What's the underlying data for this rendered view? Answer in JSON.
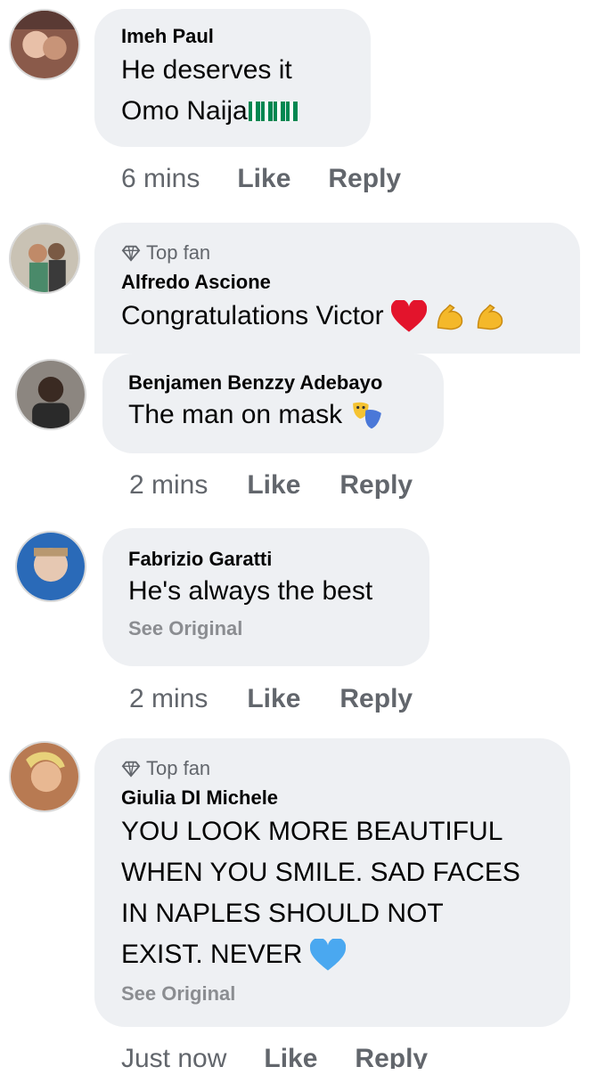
{
  "comments": [
    {
      "name": "Imeh Paul",
      "lines": [
        "He deserves it",
        "Omo Naija"
      ],
      "time": "6 mins",
      "like": "Like",
      "reply": "Reply"
    },
    {
      "badge": "Top fan",
      "name": "Alfredo Ascione",
      "lines": [
        "Congratulations Victor"
      ]
    },
    {
      "name": "Benjamen Benzzy Adebayo",
      "lines": [
        "The man on mask"
      ],
      "time": "2 mins",
      "like": "Like",
      "reply": "Reply"
    },
    {
      "name": "Fabrizio Garatti",
      "lines": [
        "He's always the best"
      ],
      "see_original": "See Original",
      "time": "2 mins",
      "like": "Like",
      "reply": "Reply"
    },
    {
      "badge": "Top fan",
      "name": "Giulia DI Michele",
      "lines": [
        "YOU LOOK MORE BEAUTIFUL",
        "WHEN YOU SMILE. SAD FACES",
        "IN NAPLES SHOULD NOT",
        "EXIST. NEVER"
      ],
      "see_original": "See Original",
      "time": "Just now",
      "like": "Like",
      "reply": "Reply"
    }
  ],
  "colors": {
    "bubble": "#eef0f3",
    "meta_text": "#62666c",
    "nigeria_green": "#008751"
  },
  "icons": [
    "diamond-icon",
    "nigeria-flag-icon",
    "red-heart-icon",
    "flexed-biceps-icon",
    "performing-arts-icon",
    "blue-heart-icon"
  ]
}
